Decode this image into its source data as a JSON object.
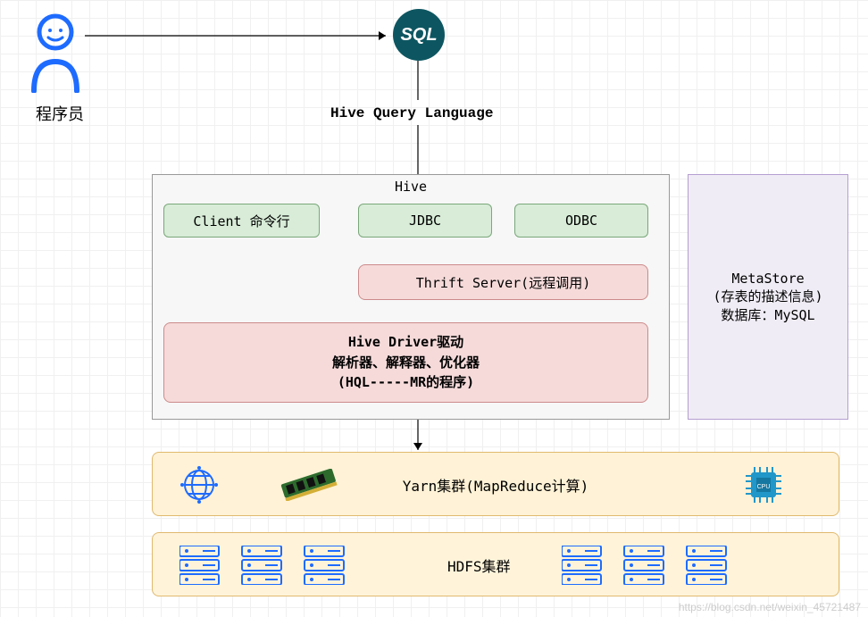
{
  "user": {
    "label": "程序员"
  },
  "sql": {
    "label": "SQL"
  },
  "hql_label": "Hive Query Language",
  "hive": {
    "title": "Hive",
    "client": "Client 命令行",
    "jdbc": "JDBC",
    "odbc": "ODBC",
    "thrift": "Thrift Server(远程调用)",
    "driver": {
      "l1": "Hive Driver驱动",
      "l2": "解析器、解释器、优化器",
      "l3": "(HQL-----MR的程序)"
    }
  },
  "metastore": {
    "l1": "MetaStore",
    "l2": "(存表的描述信息)",
    "l3": "数据库：MySQL"
  },
  "yarn": {
    "label": "Yarn集群(MapReduce计算)"
  },
  "hdfs": {
    "label": "HDFS集群"
  },
  "watermark": "https://blog.csdn.net/weixin_45721487",
  "chart_data": {
    "type": "diagram",
    "title": "Hive architecture diagram",
    "nodes": [
      {
        "id": "programmer",
        "label": "程序员"
      },
      {
        "id": "sql",
        "label": "SQL"
      },
      {
        "id": "hql",
        "label": "Hive Query Language"
      },
      {
        "id": "hive",
        "label": "Hive",
        "children": [
          "client",
          "jdbc",
          "odbc",
          "thrift",
          "driver"
        ]
      },
      {
        "id": "client",
        "label": "Client 命令行"
      },
      {
        "id": "jdbc",
        "label": "JDBC"
      },
      {
        "id": "odbc",
        "label": "ODBC"
      },
      {
        "id": "thrift",
        "label": "Thrift Server(远程调用)"
      },
      {
        "id": "driver",
        "label": "Hive Driver驱动 / 解析器、解释器、优化器 / (HQL-----MR的程序)"
      },
      {
        "id": "metastore",
        "label": "MetaStore (存表的描述信息) 数据库：MySQL"
      },
      {
        "id": "yarn",
        "label": "Yarn集群(MapReduce计算)"
      },
      {
        "id": "hdfs",
        "label": "HDFS集群"
      }
    ],
    "edges": [
      {
        "from": "programmer",
        "to": "sql"
      },
      {
        "from": "sql",
        "to": "hql"
      },
      {
        "from": "hql",
        "to": "jdbc"
      },
      {
        "from": "client",
        "to": "driver"
      },
      {
        "from": "hive",
        "to": "yarn"
      }
    ]
  }
}
